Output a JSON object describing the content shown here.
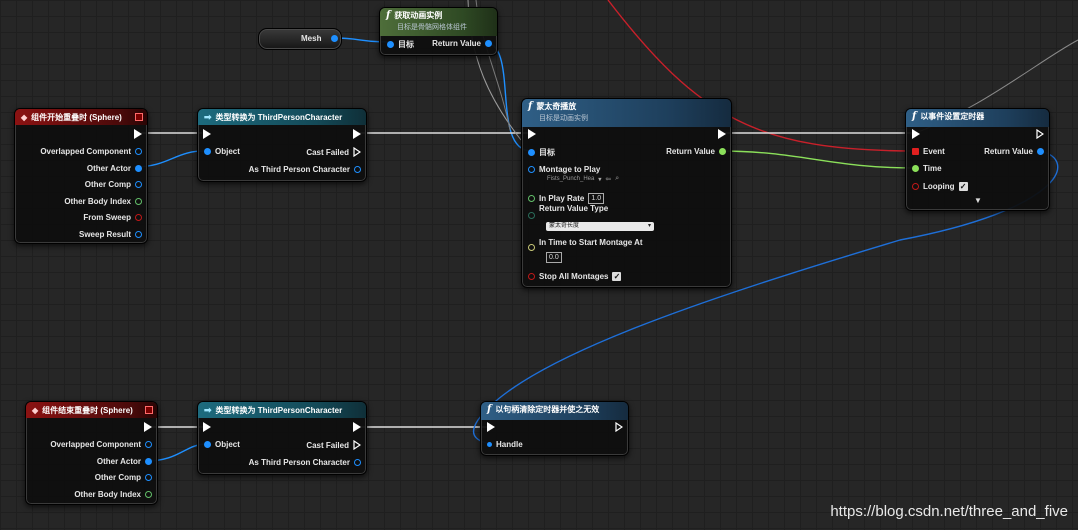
{
  "nodes": {
    "mesh_var": {
      "label": "Mesh"
    },
    "get_anim": {
      "title": "获取动画实例",
      "subtitle": "目标是骨骼网格体组件",
      "target_label": "目标",
      "return_label": "Return Value"
    },
    "begin_overlap": {
      "title": "组件开始重叠时 (Sphere)",
      "pins": [
        "Overlapped Component",
        "Other Actor",
        "Other Comp",
        "Other Body Index",
        "From Sweep",
        "Sweep Result"
      ]
    },
    "cast_1": {
      "title": "类型转换为 ThirdPersonCharacter",
      "object_label": "Object",
      "cast_failed": "Cast Failed",
      "as_label": "As Third Person Character"
    },
    "montage": {
      "title": "蒙太奇播放",
      "subtitle": "目标是动画实例",
      "target_label": "目标",
      "return_label": "Return Value",
      "montage_label": "Montage to Play",
      "montage_value": "Fists_Punch_Hea",
      "play_rate_label": "In Play Rate",
      "play_rate_value": "1.0",
      "return_type_label": "Return Value Type",
      "return_type_value": "蒙太奇长度",
      "start_label": "In Time to Start Montage At",
      "start_value": "0.0",
      "stop_all_label": "Stop All Montages",
      "stop_all_checked": true
    },
    "set_timer": {
      "title": "以事件设置定时器",
      "event_label": "Event",
      "time_label": "Time",
      "looping_label": "Looping",
      "looping_checked": true,
      "return_label": "Return Value"
    },
    "end_overlap": {
      "title": "组件结束重叠时 (Sphere)",
      "pins": [
        "Overlapped Component",
        "Other Actor",
        "Other Comp",
        "Other Body Index"
      ]
    },
    "cast_2": {
      "title": "类型转换为 ThirdPersonCharacter",
      "object_label": "Object",
      "cast_failed": "Cast Failed",
      "as_label": "As Third Person Character"
    },
    "clear_timer": {
      "title": "以句柄清除定时器并使之无效",
      "handle_label": "Handle"
    }
  },
  "watermark": "https://blog.csdn.net/three_and_five",
  "colors": {
    "exec": "#ffffff",
    "object": "#1e8fff",
    "float": "#8be05a",
    "event_delegate": "#e02020",
    "bool": "#c01818",
    "background": "#262626"
  },
  "icons": {
    "function": "function-f-icon",
    "event": "event-diamond-icon",
    "cast": "cast-arrow-icon",
    "check": "checkmark-icon",
    "expand": "chevron-down-icon"
  }
}
